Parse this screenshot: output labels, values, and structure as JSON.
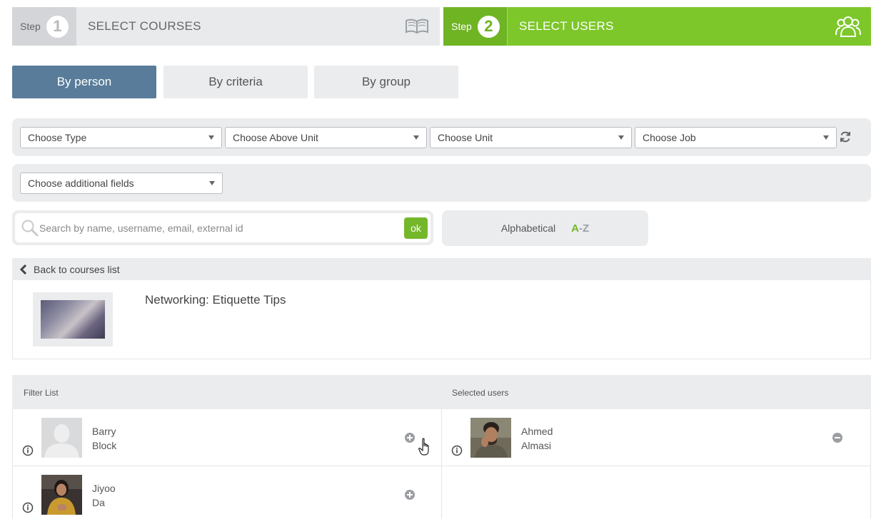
{
  "steps": [
    {
      "word": "Step",
      "num": "1",
      "title": "SELECT COURSES",
      "icon": "book-icon"
    },
    {
      "word": "Step",
      "num": "2",
      "title": "SELECT USERS",
      "icon": "users-icon"
    }
  ],
  "tabs": [
    {
      "label": "By person",
      "active": true
    },
    {
      "label": "By criteria",
      "active": false
    },
    {
      "label": "By group",
      "active": false
    }
  ],
  "filters": {
    "type": "Choose Type",
    "above_unit": "Choose Above Unit",
    "unit": "Choose Unit",
    "job": "Choose Job",
    "additional": "Choose additional fields"
  },
  "search": {
    "placeholder": "Search by name, username, email, external id",
    "ok_label": "ok"
  },
  "sort": {
    "label": "Alphabetical",
    "a": "A",
    "dash": "-",
    "z": "Z"
  },
  "back": {
    "label": "Back to courses list"
  },
  "course": {
    "title": "Networking: Etiquette Tips"
  },
  "lists": {
    "filter_header": "Filter List",
    "selected_header": "Selected users",
    "filter_users": [
      {
        "first": "Barry",
        "last": "Block",
        "avatar": "placeholder"
      },
      {
        "first": "Jiyoo",
        "last": "Da",
        "avatar": "photo"
      }
    ],
    "selected_users": [
      {
        "first": "Ahmed",
        "last": "Almasi",
        "avatar": "photo"
      }
    ]
  },
  "colors": {
    "accent_green": "#7dc72a",
    "tab_active": "#587c99",
    "panel_gray": "#ebecee"
  }
}
